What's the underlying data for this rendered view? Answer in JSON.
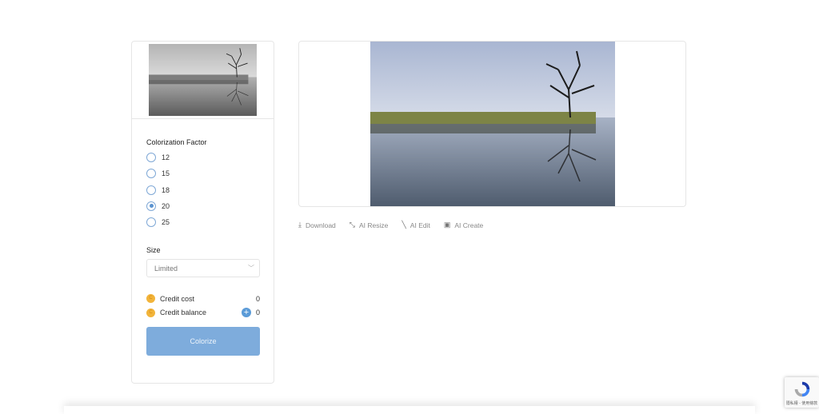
{
  "sidebar": {
    "factor_label": "Colorization Factor",
    "options": [
      {
        "value": "12",
        "selected": false
      },
      {
        "value": "15",
        "selected": false
      },
      {
        "value": "18",
        "selected": false
      },
      {
        "value": "20",
        "selected": true
      },
      {
        "value": "25",
        "selected": false
      }
    ],
    "size_label": "Size",
    "size_value": "Limited",
    "credit_cost_label": "Credit cost",
    "credit_cost": "0",
    "credit_balance_label": "Credit balance",
    "credit_balance": "0",
    "colorize_label": "Colorize"
  },
  "actions": [
    {
      "label": "Download",
      "icon": "download-icon"
    },
    {
      "label": "AI Resize",
      "icon": "resize-icon"
    },
    {
      "label": "AI Edit",
      "icon": "wand-icon"
    },
    {
      "label": "AI Create",
      "icon": "image-plus-icon"
    }
  ],
  "recaptcha": {
    "text": "隱私權 - 使用條款"
  },
  "colors": {
    "accent": "#7eacdc",
    "coin": "#f2b43a"
  }
}
